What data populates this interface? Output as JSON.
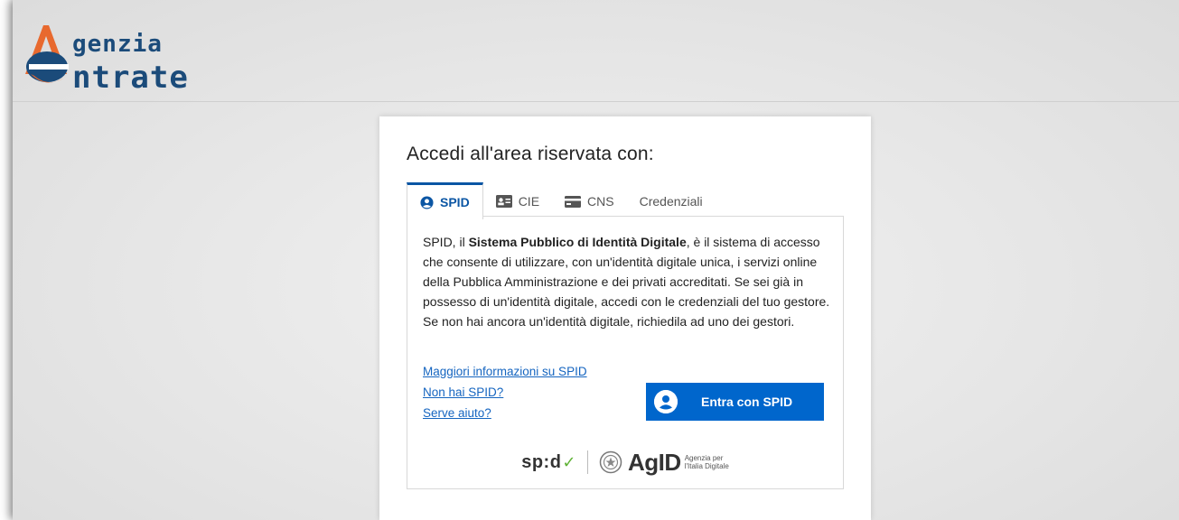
{
  "logo": {
    "line1": "genzia",
    "line2": "ntrate",
    "colors": {
      "orange": "#e8692e",
      "blue": "#1b4b7a"
    }
  },
  "login": {
    "title": "Accedi all'area riservata con:",
    "tabs": [
      {
        "label": "SPID",
        "icon": "user-circle-icon",
        "active": true
      },
      {
        "label": "CIE",
        "icon": "id-card-icon",
        "active": false
      },
      {
        "label": "CNS",
        "icon": "smart-card-icon",
        "active": false
      },
      {
        "label": "Credenziali",
        "icon": "",
        "active": false
      }
    ],
    "description": {
      "before": "SPID, il ",
      "bold": "Sistema Pubblico di Identità Digitale",
      "after": ", è il sistema di accesso che consente di utilizzare, con un'identità digitale unica, i servizi online della Pubblica Amministrazione e dei privati accreditati. Se sei già in possesso di un'identità digitale, accedi con le credenziali del tuo gestore. Se non hai ancora un'identità digitale, richiedila ad uno dei gestori."
    },
    "links": {
      "info": "Maggiori informazioni su SPID",
      "no_spid": "Non hai SPID?",
      "help": "Serve aiuto?"
    },
    "spid_button": "Entra con SPID",
    "footer": {
      "spid_logo": "sp:d",
      "agid_logo": "AgID",
      "agid_sub_1": "Agenzia per",
      "agid_sub_2": "l'Italia Digitale"
    },
    "colors": {
      "accent": "#0066cc",
      "tab_active": "#0b56a4",
      "link": "#1565c0",
      "spid_check": "#5fb236"
    }
  }
}
